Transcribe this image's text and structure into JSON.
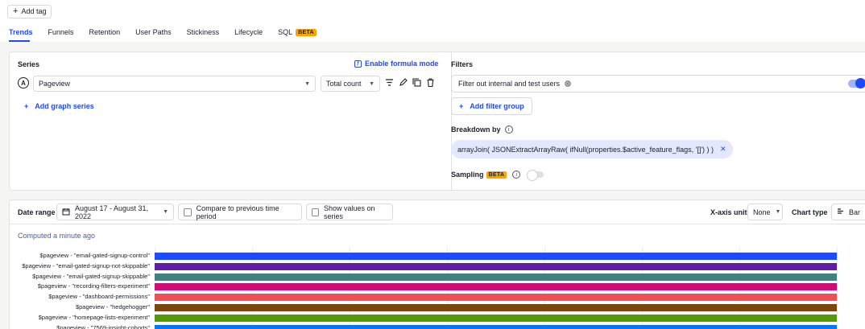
{
  "header": {
    "add_tag_label": "Add tag",
    "tabs": [
      {
        "label": "Trends",
        "active": true
      },
      {
        "label": "Funnels"
      },
      {
        "label": "Retention"
      },
      {
        "label": "User Paths"
      },
      {
        "label": "Stickiness"
      },
      {
        "label": "Lifecycle"
      },
      {
        "label": "SQL",
        "badge": "BETA"
      }
    ]
  },
  "series": {
    "title": "Series",
    "formula_label": "Enable formula mode",
    "letter": "A",
    "event": "Pageview",
    "math": "Total count",
    "add_label": "Add graph series"
  },
  "filters": {
    "title": "Filters",
    "filter_internal_label": "Filter out internal and test users",
    "filter_internal_enabled": true,
    "add_filter_group_label": "Add filter group",
    "breakdown_title": "Breakdown by",
    "breakdown_value": "arrayJoin( JSONExtractArrayRaw( ifNull(properties.$active_feature_flags, '[]') ) )",
    "sampling_label": "Sampling",
    "sampling_badge": "BETA",
    "sampling_enabled": false
  },
  "chart_toolbar": {
    "date_range_label": "Date range",
    "date_range_value": "August 17 - August 31, 2022",
    "compare_label": "Compare to previous time period",
    "show_values_label": "Show values on series",
    "x_axis_label": "X-axis unit",
    "x_axis_value": "None",
    "chart_type_label": "Chart type",
    "chart_type_value": "Bar"
  },
  "computed_text": "Computed a minute ago",
  "colors": {
    "accent": "#1d4aff",
    "beta": "#f7a501"
  },
  "chart_data": {
    "type": "bar",
    "orientation": "horizontal",
    "categories": [
      "$pageview - \"email-gated-signup-control\"",
      "$pageview - \"email-gated-signup-not-skippable\"",
      "$pageview - \"email-gated-signup-skippable\"",
      "$pageview - \"recording-filters-experiment\"",
      "$pageview - \"dashboard-permissions\"",
      "$pageview - \"hedgehogger\"",
      "$pageview - \"homepage-lists-experiment\"",
      "$pageview - \"7569-insight-cohorts\""
    ],
    "values": [
      1,
      1,
      1,
      1,
      1,
      1,
      1,
      1
    ],
    "colors": [
      "#1d4aff",
      "#621da6",
      "#42827e",
      "#ce0e74",
      "#f14f58",
      "#7c440e",
      "#529a0a",
      "#0476fb"
    ],
    "xlim": [
      0,
      1
    ],
    "grid": true
  }
}
